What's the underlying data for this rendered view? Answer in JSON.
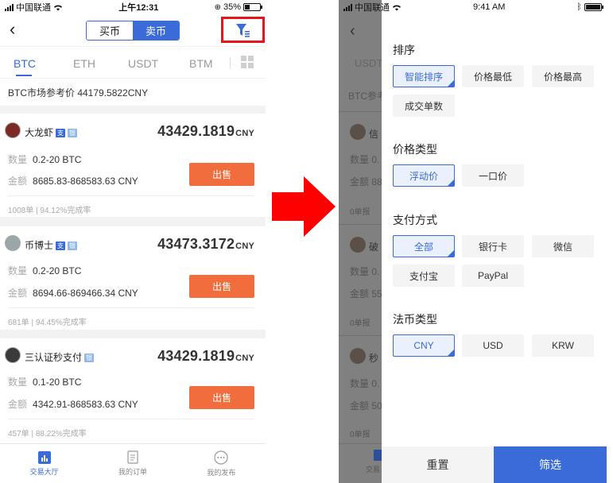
{
  "left_phone": {
    "status": {
      "carrier": "中国联通",
      "time": "上午12:31",
      "battery": "35%"
    },
    "nav": {
      "buy_label": "买币",
      "sell_label": "卖币"
    },
    "tabs": [
      "BTC",
      "ETH",
      "USDT",
      "BTM"
    ],
    "ref_price": "BTC市场参考价 44179.5822CNY",
    "cards": [
      {
        "name": "大龙虾",
        "price": "43429.1819",
        "unit": "CNY",
        "qty_label": "数量",
        "qty": "0.2-20 BTC",
        "amount_label": "金额",
        "amount": "8685.83-868583.63 CNY",
        "sell_label": "出售",
        "stats": "1008单 | 94.12%完成率"
      },
      {
        "name": "币博士",
        "price": "43473.3172",
        "unit": "CNY",
        "qty_label": "数量",
        "qty": "0.2-20 BTC",
        "amount_label": "金额",
        "amount": "8694.66-869466.34 CNY",
        "sell_label": "出售",
        "stats": "681单 | 94.45%完成率"
      },
      {
        "name": "三认证秒支付",
        "price": "43429.1819",
        "unit": "CNY",
        "qty_label": "数量",
        "qty": "0.1-20 BTC",
        "amount_label": "金额",
        "amount": "4342.91-868583.63 CNY",
        "sell_label": "出售",
        "stats": "457单 | 88.22%完成率"
      }
    ],
    "bottom_nav": [
      "交易大厅",
      "我的订单",
      "我的发布"
    ]
  },
  "right_phone": {
    "status": {
      "carrier": "中国联通",
      "time": "9:41 AM"
    },
    "behind": {
      "tab_fragment": "USDT",
      "ref_fragment": "BTC参考",
      "names": [
        "信",
        "破",
        "秒"
      ],
      "qty_fragment": "数量 0.",
      "amt_fragments": [
        "金额 88",
        "金额 55",
        "金额 50"
      ],
      "stats_fragment": "0单报",
      "nav_fragment": "交易"
    },
    "sections": [
      {
        "title": "排序",
        "options": [
          "智能排序",
          "价格最低",
          "价格最高",
          "成交单数"
        ],
        "selected": 0
      },
      {
        "title": "价格类型",
        "options": [
          "浮动价",
          "一口价"
        ],
        "selected": 0
      },
      {
        "title": "支付方式",
        "options": [
          "全部",
          "银行卡",
          "微信",
          "支付宝",
          "PayPal"
        ],
        "selected": 0
      },
      {
        "title": "法币类型",
        "options": [
          "CNY",
          "USD",
          "KRW"
        ],
        "selected": 0
      }
    ],
    "reset_label": "重置",
    "apply_label": "筛选"
  },
  "colors": {
    "accent": "#3a6bd9",
    "sell": "#f26d3d",
    "highlight": "#e8141c",
    "arrow": "#ff0000"
  }
}
